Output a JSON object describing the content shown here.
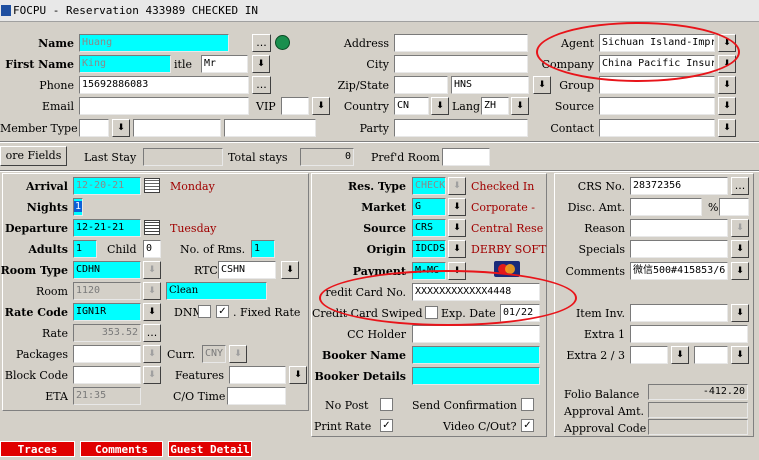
{
  "window": {
    "title": "FOCPU - Reservation 433989  CHECKED IN"
  },
  "guest": {
    "name_label": "Name",
    "name": "Huang",
    "first_name_label": "First Name",
    "first_name": "King",
    "title_label": "itle",
    "title": "Mr",
    "phone_label": "Phone",
    "phone": "15692886083",
    "email_label": "Email",
    "email": "",
    "vip_label": "VIP",
    "vip": "",
    "member_type_label": "Member Type",
    "member_type": "",
    "member_number": "",
    "member_extra": "",
    "address_label": "Address",
    "address": "",
    "city_label": "City",
    "city": "",
    "zip_state_label": "Zip/State",
    "zip": "",
    "state": "HNS",
    "country_label": "Country",
    "country": "CN",
    "lang_label": "Lang",
    "lang": "ZH",
    "party_label": "Party",
    "party": "",
    "lookup_btn": "..."
  },
  "profile": {
    "agent_label": "Agent",
    "agent": "Sichuan Island-Impr",
    "company_label": "Company",
    "company": "China Pacific Insur",
    "group_label": "Group",
    "group": "",
    "source_label": "Source",
    "source": "",
    "contact_label": "Contact",
    "contact": ""
  },
  "stay": {
    "more_fields_btn": "ore Fields",
    "last_stay_label": "Last Stay",
    "last_stay": "",
    "total_stays_label": "Total stays",
    "total_stays": "0",
    "pref_room_label": "Pref'd Room",
    "pref_room": "",
    "arrival_label": "Arrival",
    "arrival": "12-20-21",
    "arrival_day": "Monday",
    "nights_label": "Nights",
    "nights": "1",
    "departure_label": "Departure",
    "departure": "12-21-21",
    "departure_day": "Tuesday",
    "adults_label": "Adults",
    "adults": "1",
    "child_label": "Child",
    "child": "0",
    "rooms_label": "No. of Rms.",
    "rooms": "1",
    "room_type_label": "Room Type",
    "room_type": "CDHN",
    "rtc_label": "RTC",
    "rtc": "CSHN",
    "room_label": "Room",
    "room": "1120",
    "room_status": "Clean",
    "rate_code_label": "Rate Code",
    "rate_code": "IGN1R",
    "dnm_label": "DNM",
    "fixed_rate_mark": "✓",
    "fixed_rate_label": ". Fixed Rate",
    "rate_label": "Rate",
    "rate": "353.52",
    "packages_label": "Packages",
    "packages": "",
    "curr_label": "Curr.",
    "curr": "CNY",
    "block_code_label": "Block Code",
    "block_code": "",
    "features_label": "Features",
    "features": "",
    "eta_label": "ETA",
    "eta": "21:35",
    "co_time_label": "C/O Time",
    "co_time": ""
  },
  "res": {
    "res_type_label": "Res. Type",
    "res_type": "CHECKI",
    "res_type_desc": "Checked In",
    "market_label": "Market",
    "market": "G",
    "market_desc": "Corporate -",
    "source_label": "Source",
    "source": "CRS",
    "source_desc": "Central Rese",
    "origin_label": "Origin",
    "origin": "IDCDS",
    "origin_desc": "DERBY SOFT",
    "payment_label": "Payment",
    "payment": "M-MC",
    "cc_no_label": "redit Card No.",
    "cc_no": "XXXXXXXXXXXX4448",
    "cc_swiped_label": "Credit Card Swiped",
    "exp_date_label": "Exp. Date",
    "exp_date": "01/22",
    "cc_holder_label": "CC Holder",
    "cc_holder": "",
    "booker_name_label": "Booker Name",
    "booker_name": "",
    "booker_details_label": "Booker Details",
    "booker_details": "",
    "no_post_label": "No Post",
    "send_conf_label": "Send Confirmation",
    "print_rate_label": "Print Rate",
    "print_rate_mark": "✓",
    "video_co_label": "Video C/Out?",
    "video_co_mark": "✓"
  },
  "folio": {
    "crs_no_label": "CRS No.",
    "crs_no": "28372356",
    "disc_amt_label": "Disc. Amt.",
    "disc_amt": "",
    "percent_sign": "%",
    "disc_percent": "",
    "reason_label": "Reason",
    "reason": "",
    "specials_label": "Specials",
    "specials": "",
    "comments_label": "Comments",
    "comments": "微信500#415853/6",
    "item_inv_label": "Item Inv.",
    "item_inv": "",
    "extra1_label": "Extra 1",
    "extra1": "",
    "extra23_label": "Extra 2 / 3",
    "extra2": "",
    "extra3": "",
    "balance_label": "Folio Balance",
    "balance": "-412.20",
    "approval_amt_label": "Approval Amt.",
    "approval_amt": "",
    "approval_code_label": "Approval Code",
    "approval_code": ""
  },
  "bottom": {
    "traces": "Traces",
    "comments": "Comments",
    "guest_detail": "Guest Detail"
  },
  "colors": {
    "required_field": "#00ffff",
    "annotation": "#e8141a",
    "description_text": "#a00000",
    "bottom_tab": "#e00000"
  }
}
